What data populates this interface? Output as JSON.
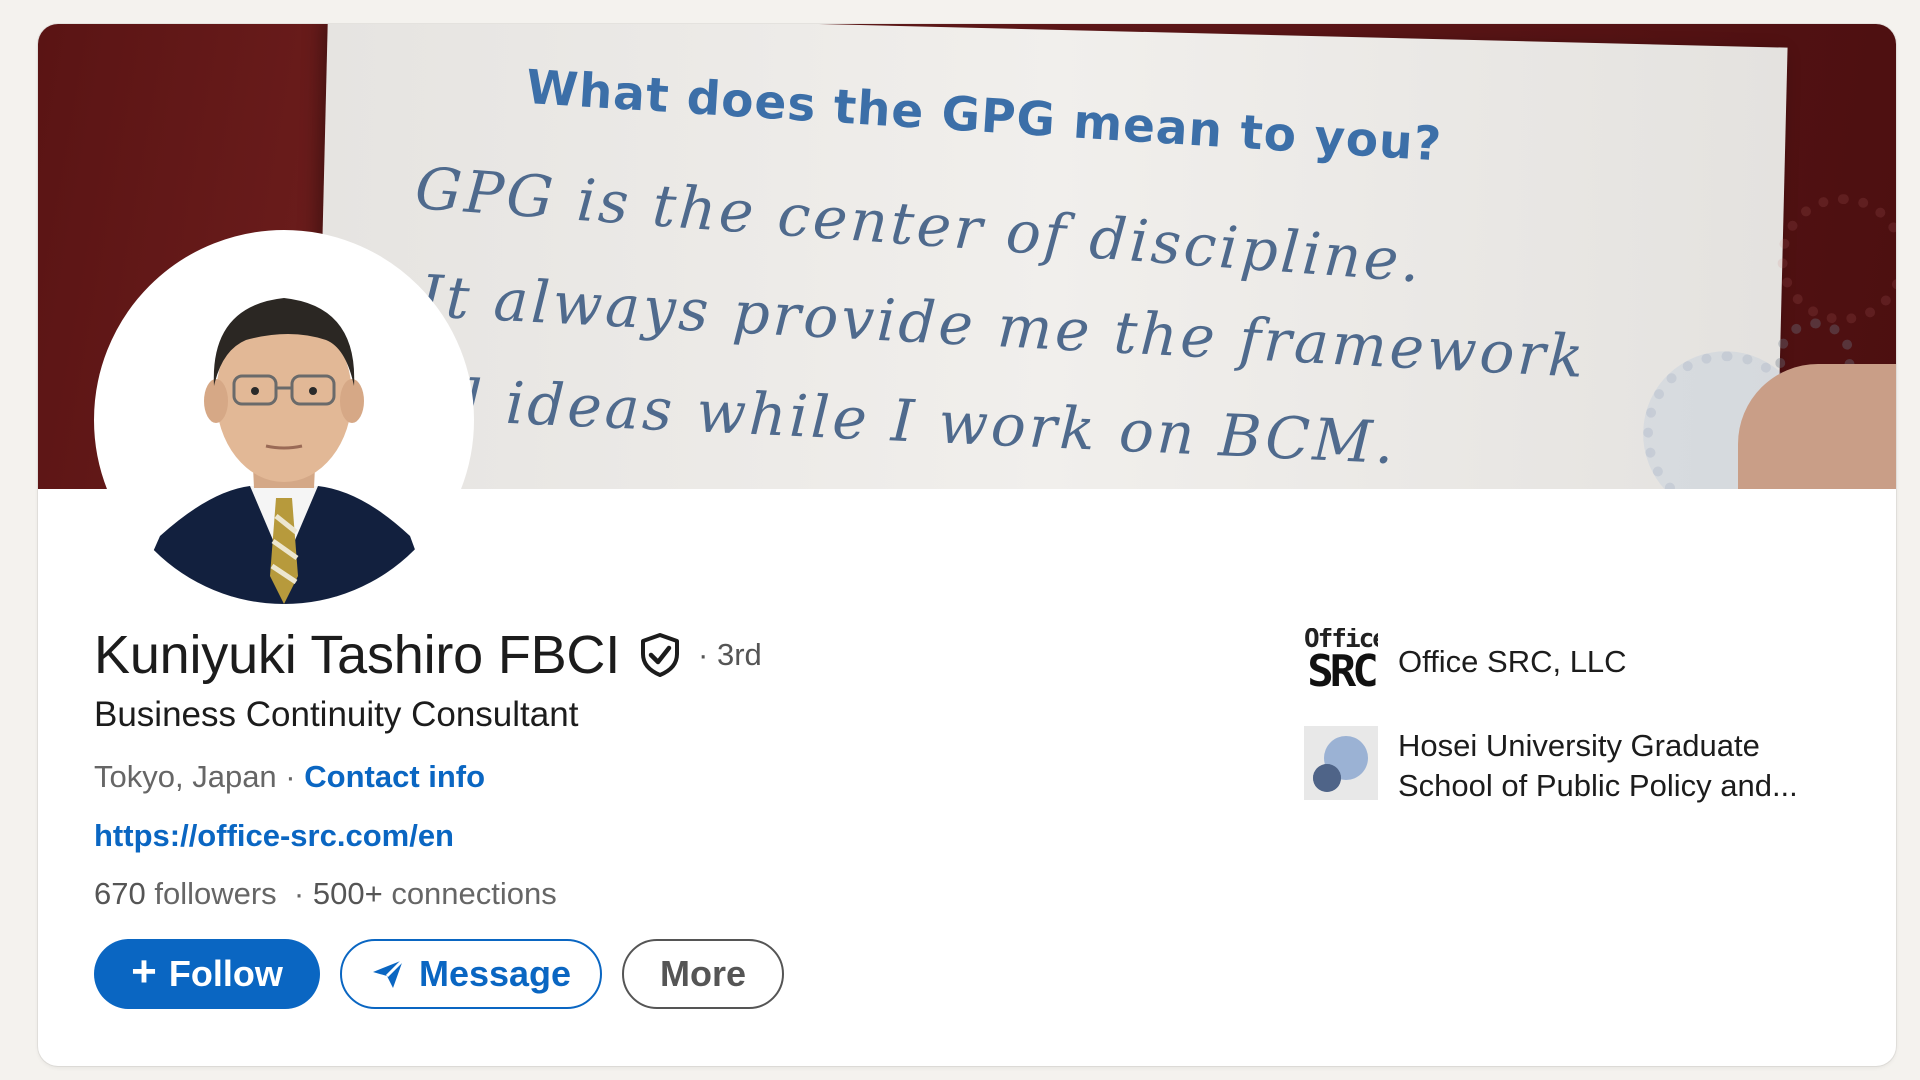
{
  "banner": {
    "heading": "What does the GPG mean to you?",
    "handwriting": [
      "GPG is the center of discipline.",
      "It always provide me the framework",
      "d ideas while I work on BCM."
    ]
  },
  "profile": {
    "name": "Kuniyuki Tashiro FBCI",
    "degree": "· 3rd",
    "headline": "Business Continuity Consultant",
    "location": "Tokyo, Japan",
    "location_separator": "·",
    "contact_info": "Contact info",
    "website": "https://office-src.com/en",
    "followers_count": "670",
    "followers_label": "followers",
    "connections_count": "500+",
    "connections_label": "connections"
  },
  "actions": {
    "follow_label": "Follow",
    "message_label": "Message",
    "more_label": "More"
  },
  "orgs": [
    {
      "name": "Office SRC, LLC",
      "logo_top": "Office",
      "logo_bottom": "SRC"
    },
    {
      "name": "Hosei University Graduate School of Public Policy and..."
    }
  ],
  "colors": {
    "accent": "#0a66c2",
    "banner_red": "#5e1718",
    "text_primary": "#1c1c1c",
    "text_secondary": "#666666"
  },
  "icons": {
    "verified": "shield-check-icon",
    "follow": "plus-icon",
    "message": "paper-plane-icon"
  }
}
